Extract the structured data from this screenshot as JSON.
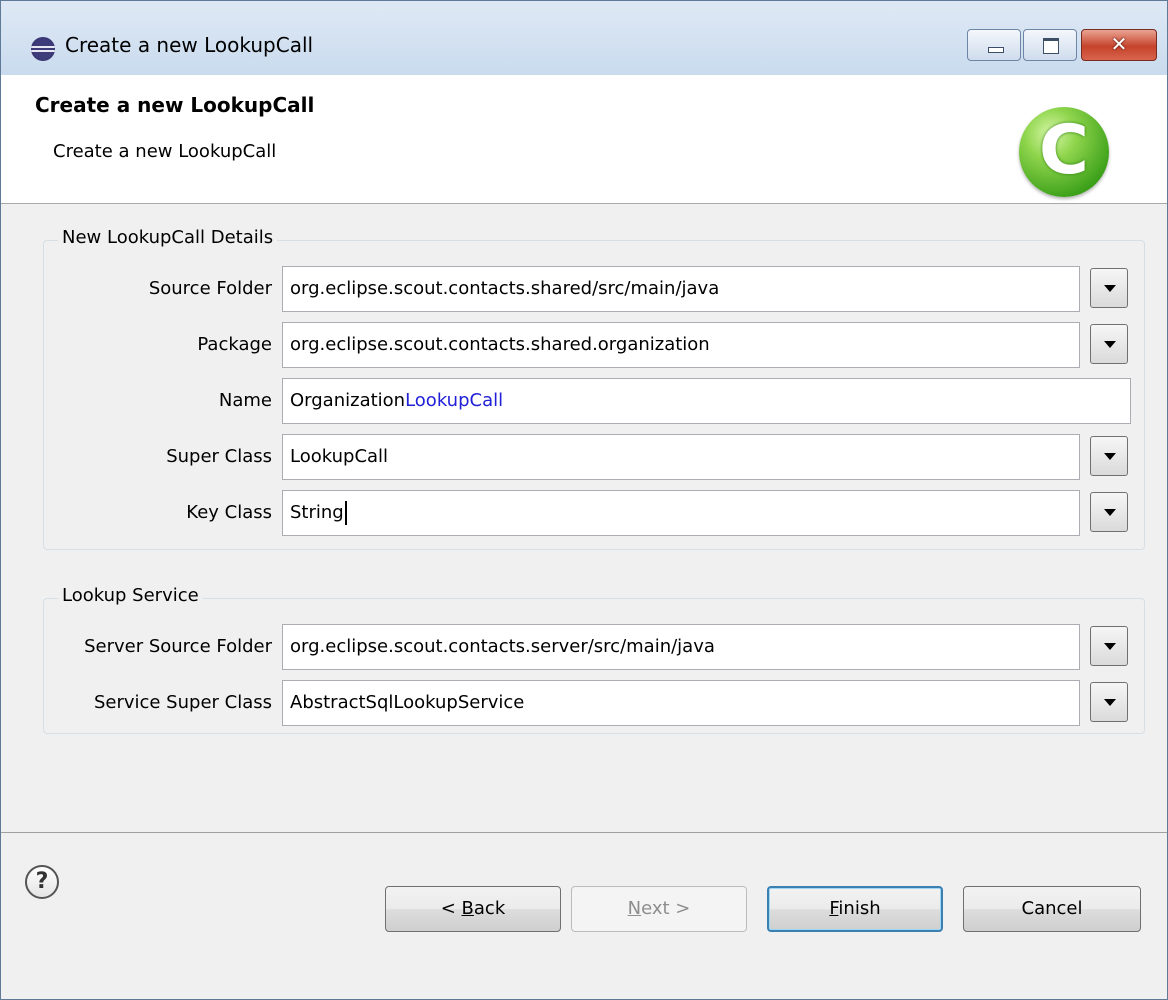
{
  "window": {
    "title": "Create a new LookupCall",
    "close_glyph": "✕",
    "icons": {
      "app": "eclipse-icon",
      "minimize": "minimize-icon",
      "maximize": "maximize-icon",
      "close": "close-icon"
    }
  },
  "banner": {
    "title": "Create a new LookupCall",
    "description": "Create a new LookupCall",
    "logo_letter": "C",
    "logo_icon": "scout-class-icon"
  },
  "details_group": {
    "legend": "New LookupCall Details",
    "fields": [
      {
        "label": "Source Folder",
        "value": "org.eclipse.scout.contacts.shared/src/main/java",
        "has_dropdown": true
      },
      {
        "label": "Package",
        "value": "org.eclipse.scout.contacts.shared.organization",
        "has_dropdown": true
      },
      {
        "label": "Name",
        "value_prefix": "Organization",
        "value_suffix": "LookupCall",
        "has_dropdown": false
      },
      {
        "label": "Super Class",
        "value": "LookupCall",
        "has_dropdown": true
      },
      {
        "label": "Key Class",
        "value": "String",
        "has_dropdown": true,
        "focused": true
      }
    ]
  },
  "service_group": {
    "legend": "Lookup Service",
    "fields": [
      {
        "label": "Server Source Folder",
        "value": "org.eclipse.scout.contacts.server/src/main/java",
        "has_dropdown": true
      },
      {
        "label": "Service Super Class",
        "value": "AbstractSqlLookupService",
        "has_dropdown": true
      }
    ]
  },
  "footer": {
    "help_glyph": "?",
    "help_icon": "help-icon",
    "back": {
      "mnemonic": "B",
      "rest": "ack",
      "prefix": "< "
    },
    "next": {
      "mnemonic": "N",
      "rest": "ext",
      "suffix": " >",
      "disabled": true
    },
    "finish": {
      "mnemonic": "F",
      "rest": "inish",
      "default": true
    },
    "cancel": "Cancel"
  },
  "colors": {
    "accent_text": "#2020d8",
    "window_frame": "#c7d9ec",
    "panel_bg": "#f0f0f0"
  }
}
